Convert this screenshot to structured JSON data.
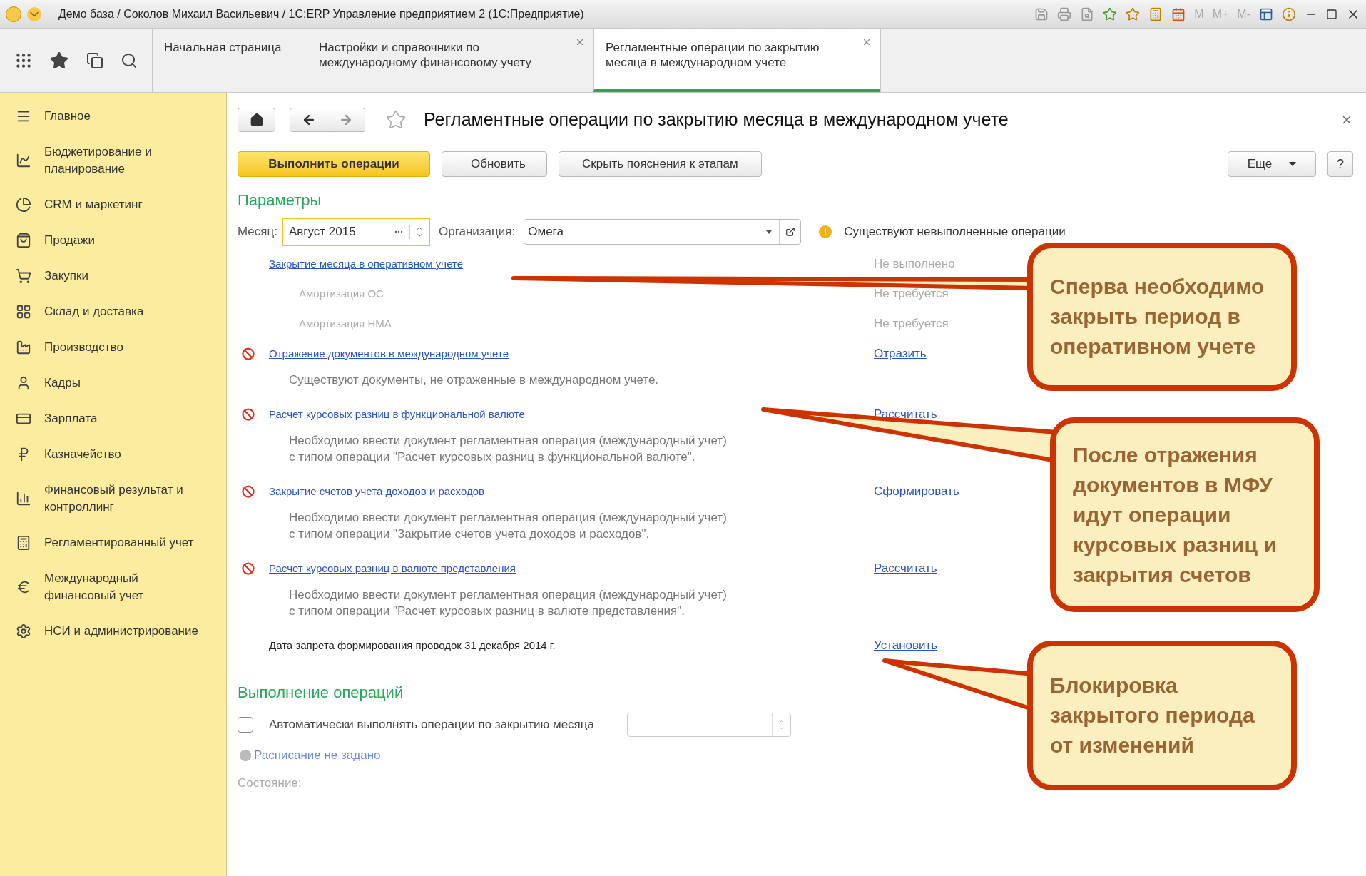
{
  "window": {
    "title": "Демо база / Соколов Михаил Васильевич / 1С:ERP Управление предприятием 2  (1С:Предприятие)",
    "memory_buttons": [
      "M",
      "M+",
      "M-"
    ]
  },
  "tabs": [
    {
      "label": "Начальная страница",
      "selected": false,
      "closable": false
    },
    {
      "label": "Настройки и справочники по международному финансовому учету",
      "selected": false,
      "closable": true
    },
    {
      "label": "Регламентные операции по закрытию месяца в международном учете",
      "selected": true,
      "closable": true
    }
  ],
  "sidebar": {
    "items": [
      {
        "label": "Главное"
      },
      {
        "label": "Бюджетирование и планирование"
      },
      {
        "label": "CRM и маркетинг"
      },
      {
        "label": "Продажи"
      },
      {
        "label": "Закупки"
      },
      {
        "label": "Склад и доставка"
      },
      {
        "label": "Производство"
      },
      {
        "label": "Кадры"
      },
      {
        "label": "Зарплата"
      },
      {
        "label": "Казначейство"
      },
      {
        "label": "Финансовый результат и контроллинг"
      },
      {
        "label": "Регламентированный учет"
      },
      {
        "label": "Международный финансовый учет"
      },
      {
        "label": "НСИ и администрирование"
      }
    ]
  },
  "form": {
    "title": "Регламентные операции по закрытию месяца в международном учете",
    "buttons": [
      {
        "label": "Выполнить операции",
        "kind": "primary"
      },
      {
        "label": "Обновить",
        "kind": "refresh"
      },
      {
        "label": "Скрыть пояснения к этапам",
        "kind": "plain"
      }
    ],
    "more_button": "Еще",
    "help_button": "?",
    "parameters_heading": "Параметры",
    "month": {
      "label": "Месяц:",
      "value": "Август 2015"
    },
    "organization": {
      "label": "Организация:",
      "value": "Омега"
    },
    "warning": "Существуют невыполненные операции",
    "operations": [
      {
        "title": "Закрытие месяца в оперативном учете",
        "error": false,
        "status": "Не выполнено",
        "children": [
          {
            "title": "Амортизация ОС",
            "status": "Не требуется"
          },
          {
            "title": "Амортизация НМА",
            "status": "Не требуется"
          }
        ]
      },
      {
        "title": "Отражение документов в международном учете",
        "error": true,
        "action": "Отразить",
        "note": "Существуют документы, не отраженные в международном учете."
      },
      {
        "title": "Расчет курсовых разниц в функциональной валюте",
        "error": true,
        "action": "Рассчитать",
        "note": "Необходимо ввести документ регламентная операция (международный учет)\nс типом операции \"Расчет курсовых разниц в функциональной валюте\"."
      },
      {
        "title": "Закрытие счетов учета доходов и расходов",
        "error": true,
        "action": "Сформировать",
        "note": "Необходимо ввести документ регламентная операция (международный учет)\nс типом операции \"Закрытие счетов учета доходов и расходов\"."
      },
      {
        "title": "Расчет курсовых разниц в валюте представления",
        "error": true,
        "action": "Рассчитать",
        "note": "Необходимо ввести документ регламентная операция (международный учет)\nс типом операции \"Расчет курсовых разниц в валюте представления\"."
      }
    ],
    "ban_date": {
      "text": "Дата запрета формирования проводок 31 декабря 2014 г.",
      "action": "Установить"
    },
    "execution_heading": "Выполнение операций",
    "auto_run": {
      "label": "Автоматически выполнять операции по закрытию месяца",
      "checked": false
    },
    "schedule_link": "Расписание не задано",
    "state_label": "Состояние:"
  },
  "callouts": [
    {
      "text": "Сперва необходимо закрыть период в оперативном учете"
    },
    {
      "text": "После отражения документов в МФУ идут операции курсовых разниц и закрытия счетов"
    },
    {
      "text": "Блокировка закрытого периода от изменений"
    }
  ]
}
